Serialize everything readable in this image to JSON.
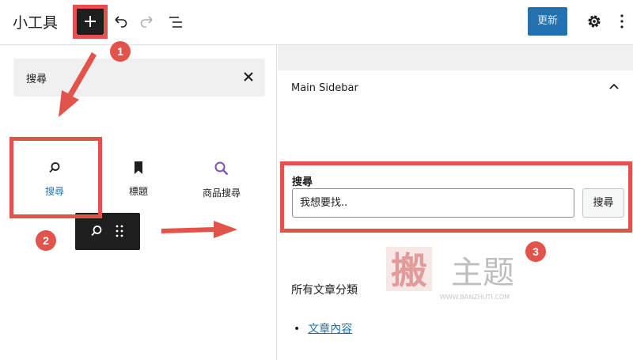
{
  "topbar": {
    "title": "小工具",
    "update_label": "更新"
  },
  "inserter": {
    "search_value": "搜尋",
    "blocks": [
      {
        "label": "搜尋",
        "icon": "search-icon",
        "selected": true
      },
      {
        "label": "標題",
        "icon": "bookmark-icon",
        "selected": false
      },
      {
        "label": "商品搜尋",
        "icon": "magnifier-icon",
        "selected": false
      }
    ]
  },
  "editor": {
    "sidebar_title": "Main Sidebar",
    "search_widget": {
      "label": "搜尋",
      "input_value": "我想要找..",
      "button_label": "搜尋"
    },
    "categories_title": "所有文章分類",
    "categories": [
      "文章內容"
    ]
  },
  "watermark": {
    "text": "搬主题",
    "url": "WWW.BANZHUTI.COM"
  },
  "annotations": {
    "step1": "1",
    "step2": "2",
    "step3": "3",
    "color": "#e2534b"
  },
  "colors": {
    "accent": "#2271b1",
    "dark": "#1e1e1e",
    "product_search": "#7f54b3"
  }
}
